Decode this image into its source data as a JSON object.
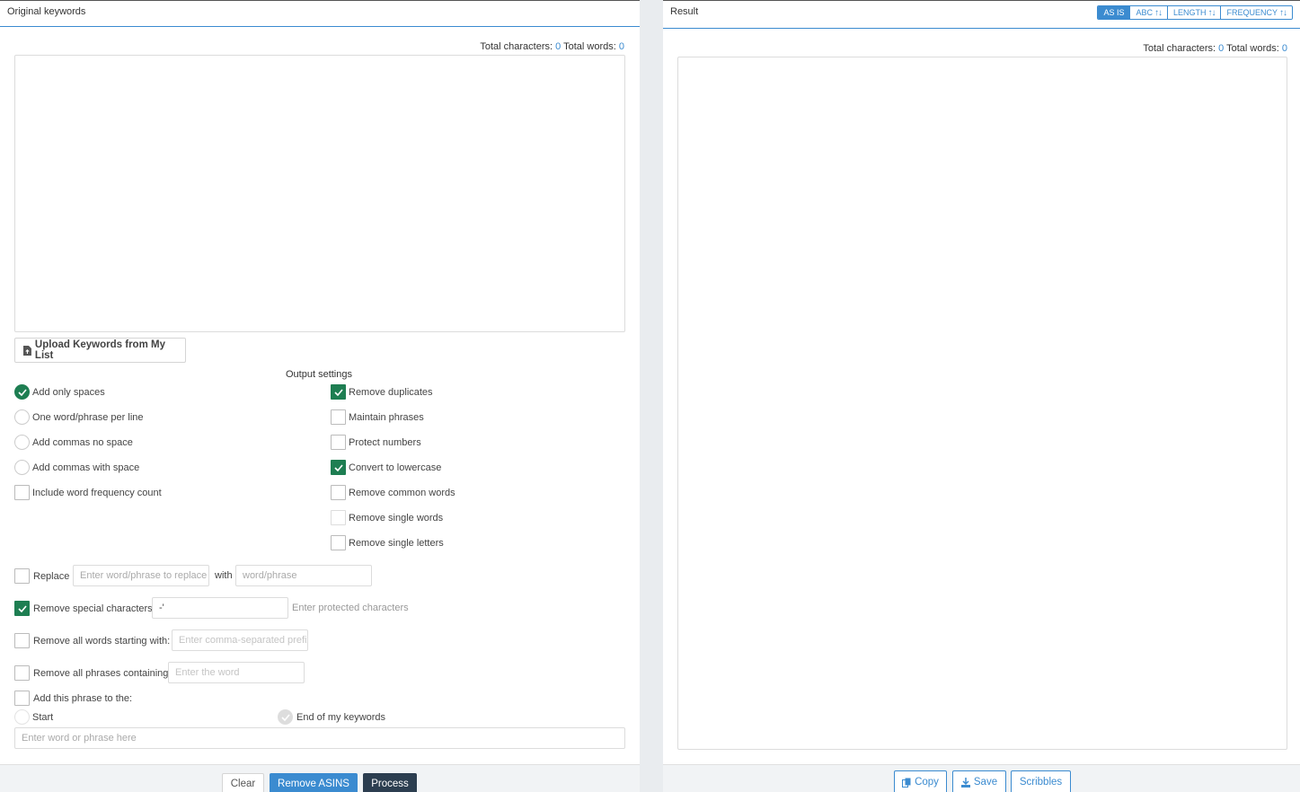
{
  "left": {
    "title": "Original keywords",
    "counts": {
      "chars_label": "Total characters:",
      "chars": "0",
      "words_label": "Total words:",
      "words": "0"
    },
    "upload_label": "Upload Keywords from My List",
    "output_settings_title": "Output settings",
    "radios": [
      {
        "label": "Add only spaces",
        "checked": true
      },
      {
        "label": "One word/phrase per line",
        "checked": false
      },
      {
        "label": "Add commas no space",
        "checked": false
      },
      {
        "label": "Add commas with space",
        "checked": false
      }
    ],
    "freq_label": "Include word frequency count",
    "checks": [
      {
        "label": "Remove duplicates",
        "checked": true
      },
      {
        "label": "Maintain phrases",
        "checked": false
      },
      {
        "label": "Protect numbers",
        "checked": false
      },
      {
        "label": "Convert to lowercase",
        "checked": true
      },
      {
        "label": "Remove common words",
        "checked": false
      },
      {
        "label": "Remove single words",
        "checked": false
      },
      {
        "label": "Remove single letters",
        "checked": false
      }
    ],
    "replace": {
      "label": "Replace",
      "placeholder": "Enter word/phrase to replace",
      "with_label": "with",
      "with_placeholder": "word/phrase"
    },
    "special": {
      "label": "Remove special characters:",
      "value": "-'",
      "hint": "Enter protected characters"
    },
    "starting": {
      "label": "Remove all words starting with:",
      "placeholder": "Enter comma-separated prefixes"
    },
    "containing": {
      "label": "Remove all phrases containing:",
      "placeholder": "Enter the word"
    },
    "add_phrase": {
      "label": "Add this phrase to the:",
      "start_label": "Start",
      "end_label": "End of my keywords",
      "placeholder": "Enter word or phrase here"
    },
    "footer": {
      "clear": "Clear",
      "remove_asins": "Remove ASINS",
      "process": "Process"
    }
  },
  "right": {
    "title": "Result",
    "sort": [
      {
        "label": "AS IS",
        "active": true,
        "arrows": ""
      },
      {
        "label": "ABC",
        "active": false,
        "arrows": "↑↓"
      },
      {
        "label": "LENGTH",
        "active": false,
        "arrows": "↑↓"
      },
      {
        "label": "FREQUENCY",
        "active": false,
        "arrows": "↑↓"
      }
    ],
    "counts": {
      "chars_label": "Total characters:",
      "chars": "0",
      "words_label": "Total words:",
      "words": "0"
    },
    "footer": {
      "copy": "Copy",
      "save": "Save",
      "scribbles": "Scribbles"
    }
  },
  "colors": {
    "accent": "#3b8bd0",
    "checked": "#1e7e52",
    "dark_button": "#2c3e50"
  }
}
